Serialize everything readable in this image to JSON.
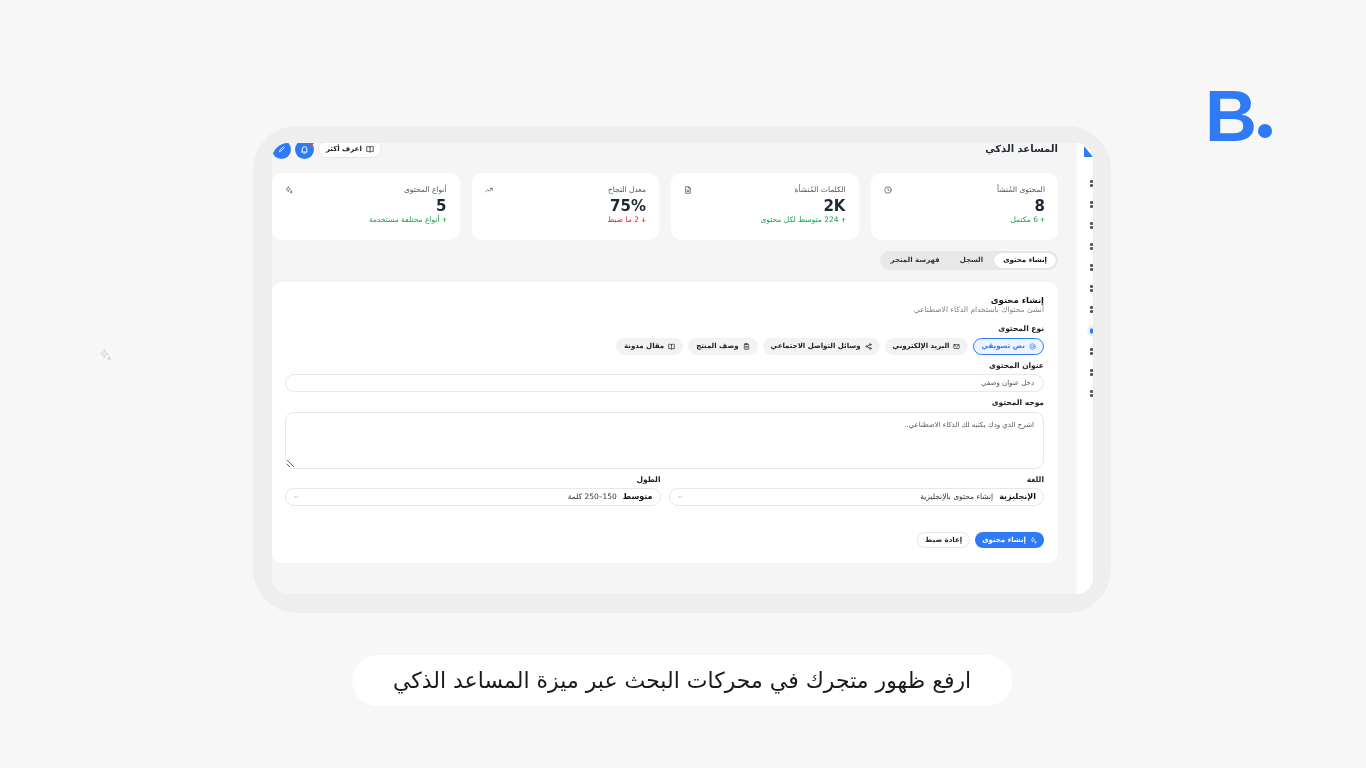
{
  "logo": {
    "letter": "B"
  },
  "app": {
    "sidebar": {
      "items": [
        {
          "selected": false
        },
        {
          "selected": false
        },
        {
          "selected": false
        },
        {
          "selected": false
        },
        {
          "selected": false
        },
        {
          "selected": false
        },
        {
          "selected": false
        },
        {
          "selected": true
        },
        {
          "selected": false
        },
        {
          "selected": false
        },
        {
          "selected": false
        }
      ]
    },
    "header": {
      "title": "المساعد الذكي",
      "learn_more": "اعرف أكثر",
      "unread": true
    },
    "stats": [
      {
        "label": "المحتوى المُنشأ",
        "value": "8",
        "note": "6 مكتمل",
        "kind": "up"
      },
      {
        "label": "الكلمات المُنشأة",
        "value": "2K",
        "note": "224 متوسط لكل محتوى",
        "kind": "up"
      },
      {
        "label": "معدل النجاح",
        "value": "75%",
        "note": "2 ما ضبط",
        "kind": "down"
      },
      {
        "label": "أنواع المحتوى",
        "value": "5",
        "note": "أنواع مختلفة مستخدمة",
        "kind": "up"
      }
    ],
    "tabs": [
      {
        "label": "إنشاء محتوى",
        "selected": true
      },
      {
        "label": "السجل",
        "selected": false
      },
      {
        "label": "فهرسة المتجر",
        "selected": false
      }
    ],
    "form": {
      "title": "إنشاء محتوى",
      "subtitle": "أنشئ محتواك باستخدام الذكاء الاصطناعي",
      "content_type": {
        "label": "نوع المحتوى",
        "options": [
          {
            "label": "نص تسويقي",
            "selected": true
          },
          {
            "label": "البريد الإلكتروني",
            "selected": false
          },
          {
            "label": "وسائل التواصل الاجتماعي",
            "selected": false
          },
          {
            "label": "وصف المنتج",
            "selected": false
          },
          {
            "label": "مقال مدونة",
            "selected": false
          }
        ]
      },
      "title_field": {
        "label": "عنوان المحتوى",
        "placeholder": "دخل عنوان وصفي"
      },
      "prompt_field": {
        "label": "موجه المحتوى",
        "placeholder": "اشرح الذي ودك يكتبه لك الذكاء الاصطناعي.."
      },
      "language": {
        "label": "اللغة",
        "value": "الإنجليزية",
        "hint": "إنشاء محتوى بالإنجليزية"
      },
      "length": {
        "label": "الطول",
        "value": "متوسط",
        "hint": "150–250 كلمة"
      },
      "buttons": [
        {
          "label": "إنشاء محتوى",
          "kind": "primary"
        },
        {
          "label": "إعادة ضبط",
          "kind": "secondary"
        }
      ]
    }
  },
  "caption": "ارفع ظهور متجرك في محركات البحث عبر ميزة المساعد الذكي"
}
